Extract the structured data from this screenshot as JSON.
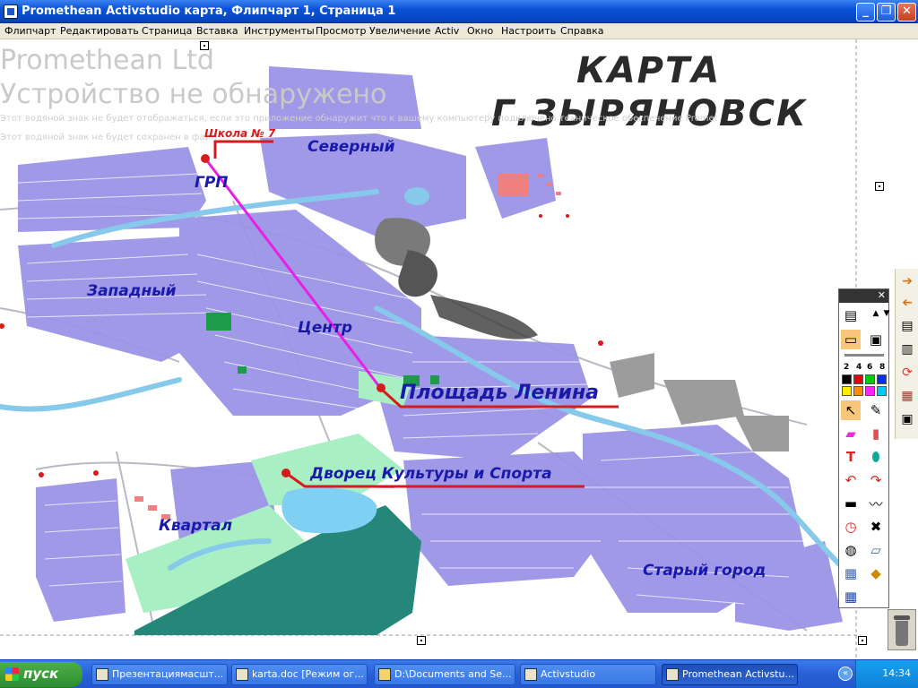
{
  "window": {
    "title": "Promethean Activstudio   карта, Флипчарт 1, Страница 1",
    "btn_minimize": "_",
    "btn_maximize": "❐",
    "btn_close": "✕"
  },
  "menu": {
    "items": [
      "Флипчарт",
      "Редактировать",
      "Страница",
      "Вставка",
      "Инструменты",
      "Просмотр",
      "Увеличение",
      "Activ",
      "Окно",
      "Настроить",
      "Справка"
    ]
  },
  "watermark": {
    "line1": "Promethean Ltd",
    "line2": "Устройство не обнаружено",
    "note1": "Этот водяной знак не будет отображаться, если это приложение обнаружит что к вашему компьютеру подключено техническое обеспечение Promethean",
    "note2": "Этот водяной знак не будет сохранен в файл"
  },
  "map": {
    "title_line1": "КАРТА",
    "title_line2": "Г.ЗЫРЯНОВСК",
    "labels": {
      "school": "Школа № 7",
      "north": "Северный",
      "grp": "ГРП",
      "west": "Западный",
      "center": "Центр",
      "lenin_square": "Площадь Ленина",
      "palace": "Дворец Культуры и Спорта",
      "quarter": "Квартал",
      "old_town": "Старый город"
    }
  },
  "toolbox": {
    "close": "✕",
    "thickness": [
      "2",
      "4",
      "6",
      "8"
    ],
    "colors": [
      "#000000",
      "#e8000b",
      "#00cc00",
      "#0030ff",
      "#ffee00",
      "#ff8a00",
      "#ff22ff",
      "#00c8ff"
    ]
  },
  "taskbar": {
    "start": "пуск",
    "tasks": [
      "Презентациямасшт...",
      "karta.doc [Режим ог...",
      "D:\\Documents and Se...",
      "Activstudio",
      "Promethean Activstu..."
    ],
    "clock": "14:34",
    "tray_expand": "«"
  }
}
